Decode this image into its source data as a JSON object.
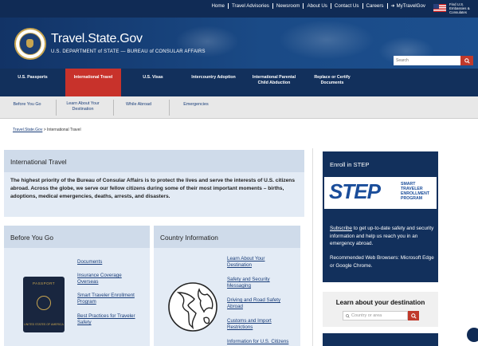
{
  "topnav": [
    "Home",
    "Travel Advisories",
    "Newsroom",
    "About Us",
    "Contact Us",
    "Careers",
    "MyTravelGov"
  ],
  "flag_text": "Find U.S. Embassies & Consulates",
  "site": {
    "title": "Travel.State.Gov",
    "subtitle": "U.S. DEPARTMENT of STATE — BUREAU of CONSULAR AFFAIRS"
  },
  "search": {
    "placeholder": "Search"
  },
  "mainnav": [
    {
      "label": "U.S. Passports",
      "active": false
    },
    {
      "label": "International Travel",
      "active": true
    },
    {
      "label": "U.S. Visas",
      "active": false
    },
    {
      "label": "Intercountry Adoption",
      "active": false
    },
    {
      "label": "International Parental Child Abduction",
      "active": false
    },
    {
      "label": "Replace or Certify Documents",
      "active": false
    }
  ],
  "subnav": [
    "Before You Go",
    "Learn About Your Destination",
    "While Abroad",
    "Emergencies"
  ],
  "breadcrumb": {
    "home": "Travel.State.Gov",
    "sep": " > ",
    "current": "International Travel"
  },
  "intro": {
    "title": "International Travel",
    "body": "The highest priority of the Bureau of Consular Affairs is to protect the lives and serve the interests of U.S. citizens abroad.   Across the globe, we serve our fellow citizens during some of their most important moments – births, adoptions, medical emergencies, deaths, arrests, and disasters."
  },
  "before_you_go": {
    "title": "Before You Go",
    "links": [
      "Documents",
      "Insurance Coverage Overseas",
      "Smart Traveler Enrollment Program",
      "Best Practices for Traveler Safety"
    ],
    "passport_text": "PASSPORT",
    "passport_sub": "UNITED STATES OF AMERICA"
  },
  "country_info": {
    "title": "Country Information",
    "links": [
      "Learn About Your Destination",
      "Safety and Security Messaging",
      "Driving and Road Safety Abroad",
      "Customs and Import Restrictions",
      "Information for U.S. Citizens"
    ]
  },
  "step": {
    "title": "Enroll in STEP",
    "logo_big": "STEP",
    "logo_line1": "SMART",
    "logo_line2": "TRAVELER",
    "logo_line3": "ENROLLMENT",
    "logo_line4": "PROGRAM",
    "subscribe_link": "Subscribe",
    "subscribe_rest": " to get up-to-date safety and security information and help us reach you in an emergency abroad.",
    "browsers": "Recommended Web Browsers: Microsoft Edge or Google Chrome."
  },
  "learn": {
    "title": "Learn about your destination",
    "placeholder": "Country or area"
  },
  "colors": {
    "navy": "#12305c",
    "red": "#c8322b",
    "panel": "#e3ebf5"
  }
}
